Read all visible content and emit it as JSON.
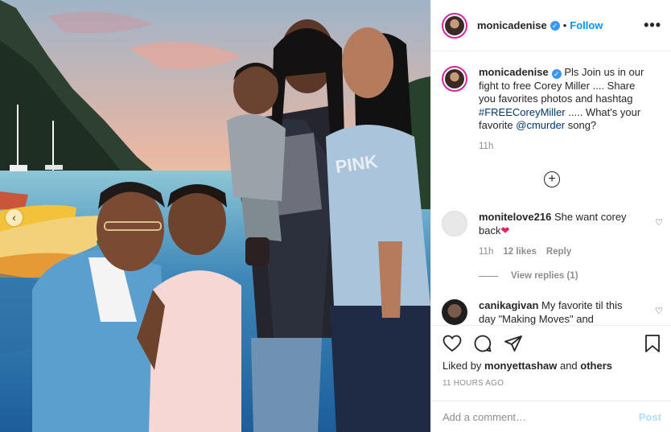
{
  "post": {
    "photo_alt": "Family portrait in front of a painted tropical harbor mural",
    "carousel_prev": "‹"
  },
  "header": {
    "username": "monicadenise",
    "dot": "•",
    "follow_label": "Follow",
    "more_label": "•••"
  },
  "caption": {
    "username": "monicadenise",
    "text_before": " Pls Join us in our fight to free Corey Miller .... Share you favorites photos and hashtag ",
    "hashtag": "#FREECoreyMiller",
    "text_middle": " ..... What's your favorite ",
    "mention": "@cmurder",
    "text_after": " song?",
    "time": "11h"
  },
  "load_more": "+",
  "comments": [
    {
      "username": "monitelove216",
      "text": " She want corey back",
      "emoji": "❤",
      "time": "11h",
      "likes": "12 likes",
      "reply": "Reply"
    },
    {
      "username": "canikagivan",
      "text": " My favorite til this day \"Making Moves\" and"
    }
  ],
  "view_replies": "View replies (1)",
  "actions": {
    "liked_by_prefix": "Liked by ",
    "liked_by_user": "monyettashaw",
    "liked_by_mid": " and ",
    "liked_by_others": "others",
    "timestamp": "11 HOURS AGO"
  },
  "add_comment": {
    "placeholder": "Add a comment…",
    "post_label": "Post"
  },
  "colors": {
    "link": "#00376b",
    "follow": "#0095f6",
    "verified": "#3897f0",
    "emoji_heart": "#e0245e"
  }
}
